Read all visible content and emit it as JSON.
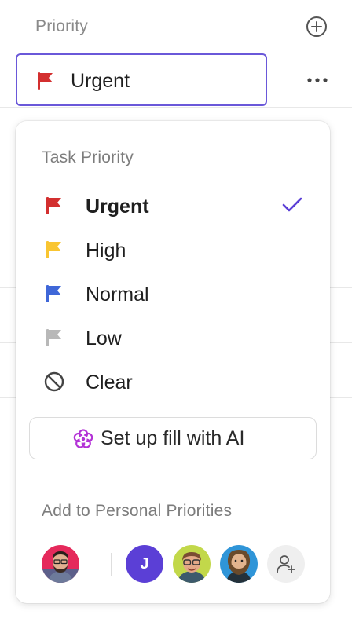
{
  "column": {
    "title": "Priority"
  },
  "cell": {
    "value": "Urgent"
  },
  "dropdown": {
    "section_title": "Task Priority",
    "options": [
      {
        "label": "Urgent",
        "icon": "flag-icon",
        "color": "#d32f2f",
        "selected": true
      },
      {
        "label": "High",
        "icon": "flag-icon",
        "color": "#f9c531",
        "selected": false
      },
      {
        "label": "Normal",
        "icon": "flag-icon",
        "color": "#3f67d8",
        "selected": false
      },
      {
        "label": "Low",
        "icon": "flag-icon",
        "color": "#b8b8b8",
        "selected": false
      },
      {
        "label": "Clear",
        "icon": "prohibited-icon",
        "color": "#444444",
        "selected": false
      }
    ],
    "ai_button": {
      "label": "Set up fill with AI",
      "icon": "ai-flower-icon",
      "color": "#b332d6"
    },
    "personal_title": "Add to Personal Priorities",
    "avatars": [
      {
        "type": "photo",
        "icon": "user-photo"
      },
      {
        "type": "letter",
        "letter": "J",
        "color": "#5b3fd6"
      },
      {
        "type": "photo",
        "icon": "user-photo"
      },
      {
        "type": "photo",
        "icon": "user-photo"
      },
      {
        "type": "add",
        "icon": "add-user-icon"
      }
    ]
  },
  "colors": {
    "accent": "#6a58d9",
    "check": "#5b3fd6"
  }
}
